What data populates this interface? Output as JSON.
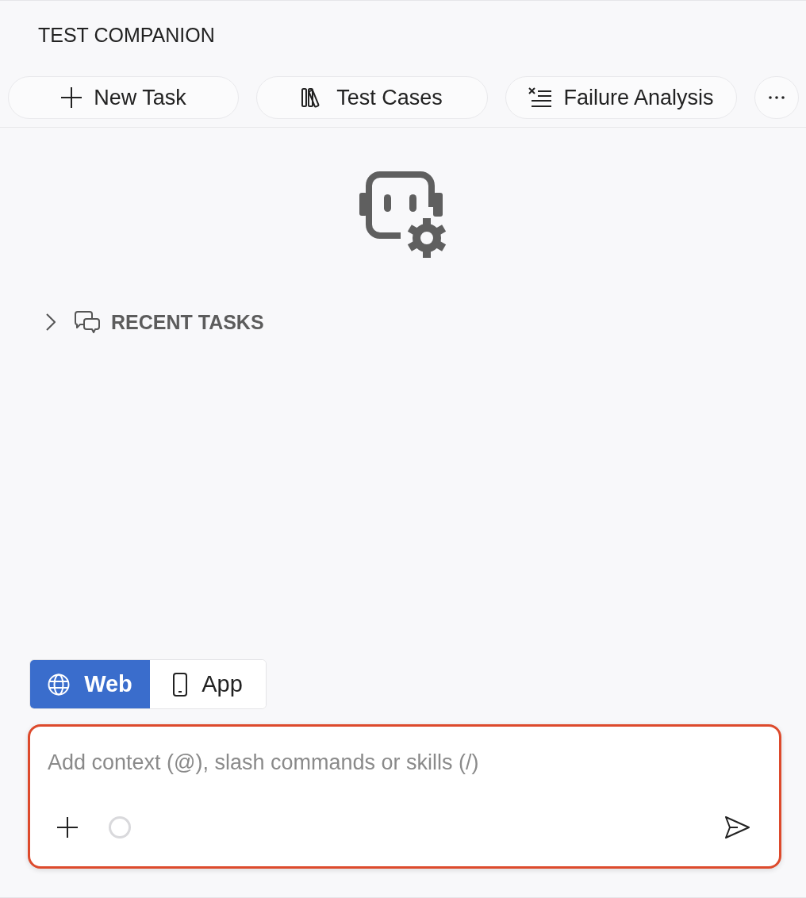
{
  "header": {
    "title": "TEST COMPANION"
  },
  "toolbar": {
    "buttons": [
      {
        "kind": "plus",
        "label": "New Task"
      },
      {
        "kind": "books",
        "label": "Test Cases"
      },
      {
        "kind": "list-x",
        "label": "Failure Analysis"
      }
    ]
  },
  "recent_tasks": {
    "label": "RECENT TASKS",
    "expanded": false
  },
  "mode_switch": [
    {
      "kind": "web",
      "label": "Web",
      "selected": true
    },
    {
      "kind": "app",
      "label": "App",
      "selected": false
    }
  ],
  "composer": {
    "placeholder": "Add context (@), slash commands or skills (/)",
    "focused": true
  }
}
